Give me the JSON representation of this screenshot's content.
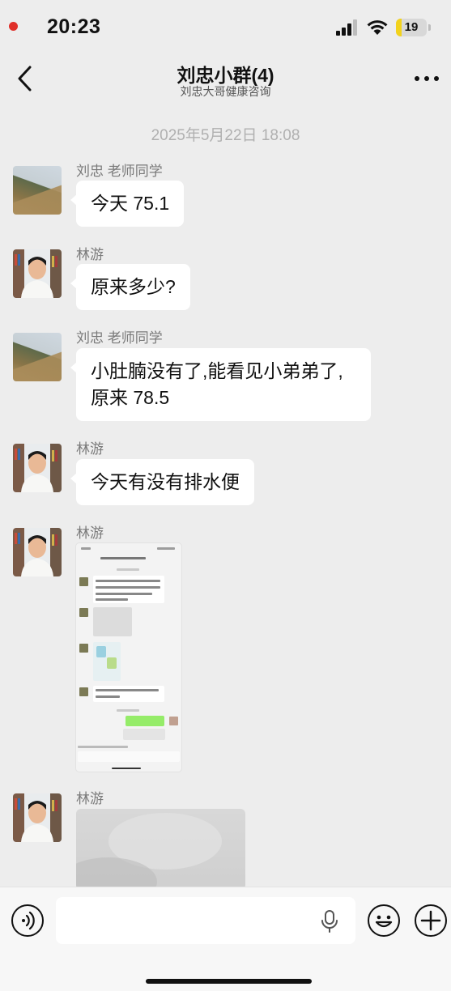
{
  "status_bar": {
    "time": "20:23",
    "battery": "19"
  },
  "header": {
    "title": "刘忠小群(4)",
    "subtitle": "刘忠大哥健康咨询"
  },
  "timestamp": "2025年5月22日 18:08",
  "messages": [
    {
      "sender": "刘忠 老师同学",
      "text": "今天 75.1",
      "avatar": "mountain-avatar"
    },
    {
      "sender": "林游",
      "text": "原来多少?",
      "avatar": "person-avatar"
    },
    {
      "sender": "刘忠 老师同学",
      "text": "小肚腩没有了,能看见小弟弟了,原来 78.5",
      "avatar": "mountain-avatar"
    },
    {
      "sender": "林游",
      "text": "今天有没有排水便",
      "avatar": "person-avatar"
    },
    {
      "sender": "林游",
      "type": "screenshot-image",
      "avatar": "person-avatar"
    },
    {
      "sender": "林游",
      "type": "photo",
      "avatar": "person-avatar"
    }
  ],
  "composer": {
    "voice_icon": "voice-icon",
    "mic_icon": "microphone-icon",
    "emoji_icon": "emoji-icon",
    "plus_icon": "plus-icon"
  }
}
